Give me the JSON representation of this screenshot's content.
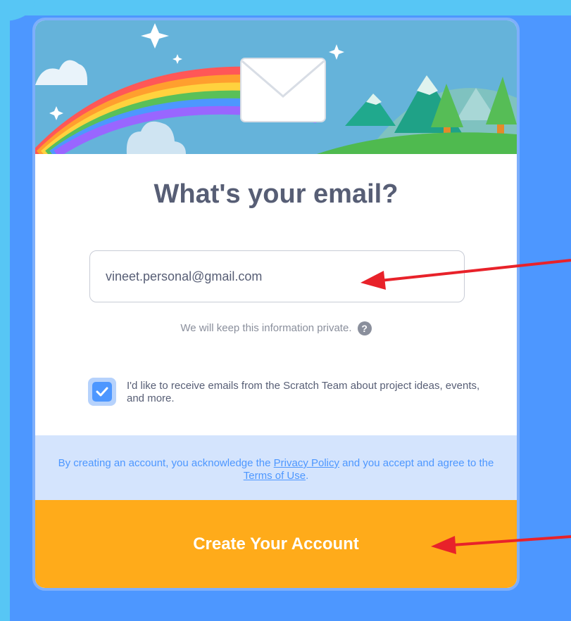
{
  "modal": {
    "title": "What's your email?",
    "email": {
      "value": "vineet.personal@gmail.com",
      "placeholder": ""
    },
    "privacy_note": "We will keep this information private.",
    "help_icon_glyph": "?",
    "optin": {
      "checked": true,
      "label": "I'd like to receive emails from the Scratch Team about project ideas, events, and more."
    },
    "legal": {
      "prefix": "By creating an account, you acknowledge the ",
      "privacy_link": "Privacy Policy",
      "middle": " and you accept and agree to the ",
      "terms_link": "Terms of Use",
      "suffix": "."
    },
    "submit_label": "Create Your Account"
  },
  "icons": {
    "banner": "rainbow-envelope-landscape-illustration",
    "help": "question-circle-icon",
    "check": "checkmark-icon",
    "annotation": "red-arrow-icon"
  },
  "colors": {
    "page_bg": "#4d97ff",
    "accent_orange": "#ffab1a",
    "text_gray": "#575e75",
    "legal_bg": "#d4e4fd",
    "annotation_red": "#e8222a"
  }
}
